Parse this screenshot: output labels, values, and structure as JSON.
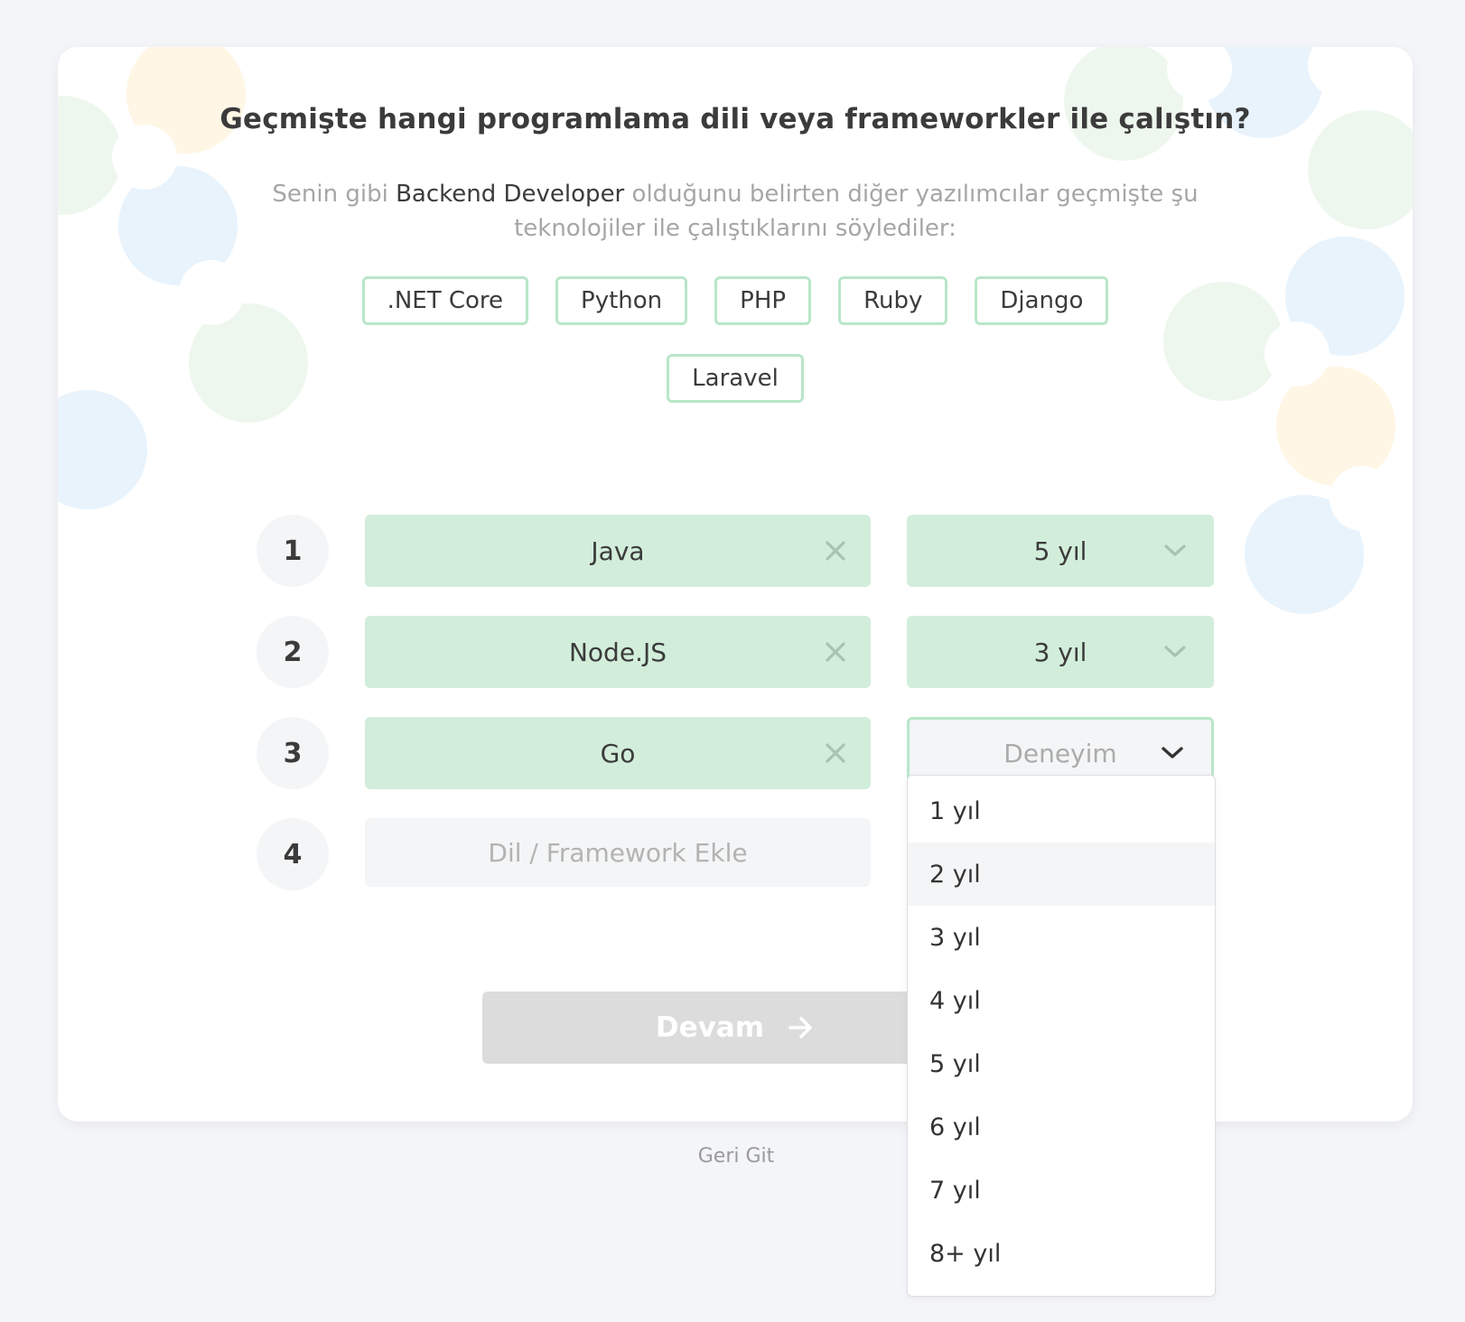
{
  "question": {
    "title": "Geçmişte hangi programlama dili veya frameworkler ile çalıştın?",
    "subtitle_before": "Senin gibi ",
    "subtitle_role": "Backend Developer",
    "subtitle_after": " olduğunu belirten diğer yazılımcılar geçmişte şu teknolojiler ile çalıştıklarını söylediler:"
  },
  "suggestions": [
    ".NET Core",
    "Python",
    "PHP",
    "Ruby",
    "Django",
    "Laravel"
  ],
  "rows": [
    {
      "number": "1",
      "language": "Java",
      "experience": "5 yıl"
    },
    {
      "number": "2",
      "language": "Node.JS",
      "experience": "3 yıl"
    },
    {
      "number": "3",
      "language": "Go",
      "experience_placeholder": "Deneyim"
    },
    {
      "number": "4",
      "language_placeholder": "Dil / Framework Ekle"
    }
  ],
  "experience_options": [
    "1 yıl",
    "2 yıl",
    "3 yıl",
    "4 yıl",
    "5 yıl",
    "6 yıl",
    "7 yıl",
    "8+ yıl"
  ],
  "highlighted_option": "2 yıl",
  "continue_label": "Devam",
  "back_label": "Geri Git",
  "colors": {
    "accent_green": "#d2eedb",
    "chip_border": "#b9e6c9",
    "page_bg": "#f4f5f9",
    "disabled_button": "#dcdcdc"
  },
  "icons": {
    "remove": "close-icon",
    "select": "chevron-down-icon",
    "continue": "arrow-right-icon"
  }
}
